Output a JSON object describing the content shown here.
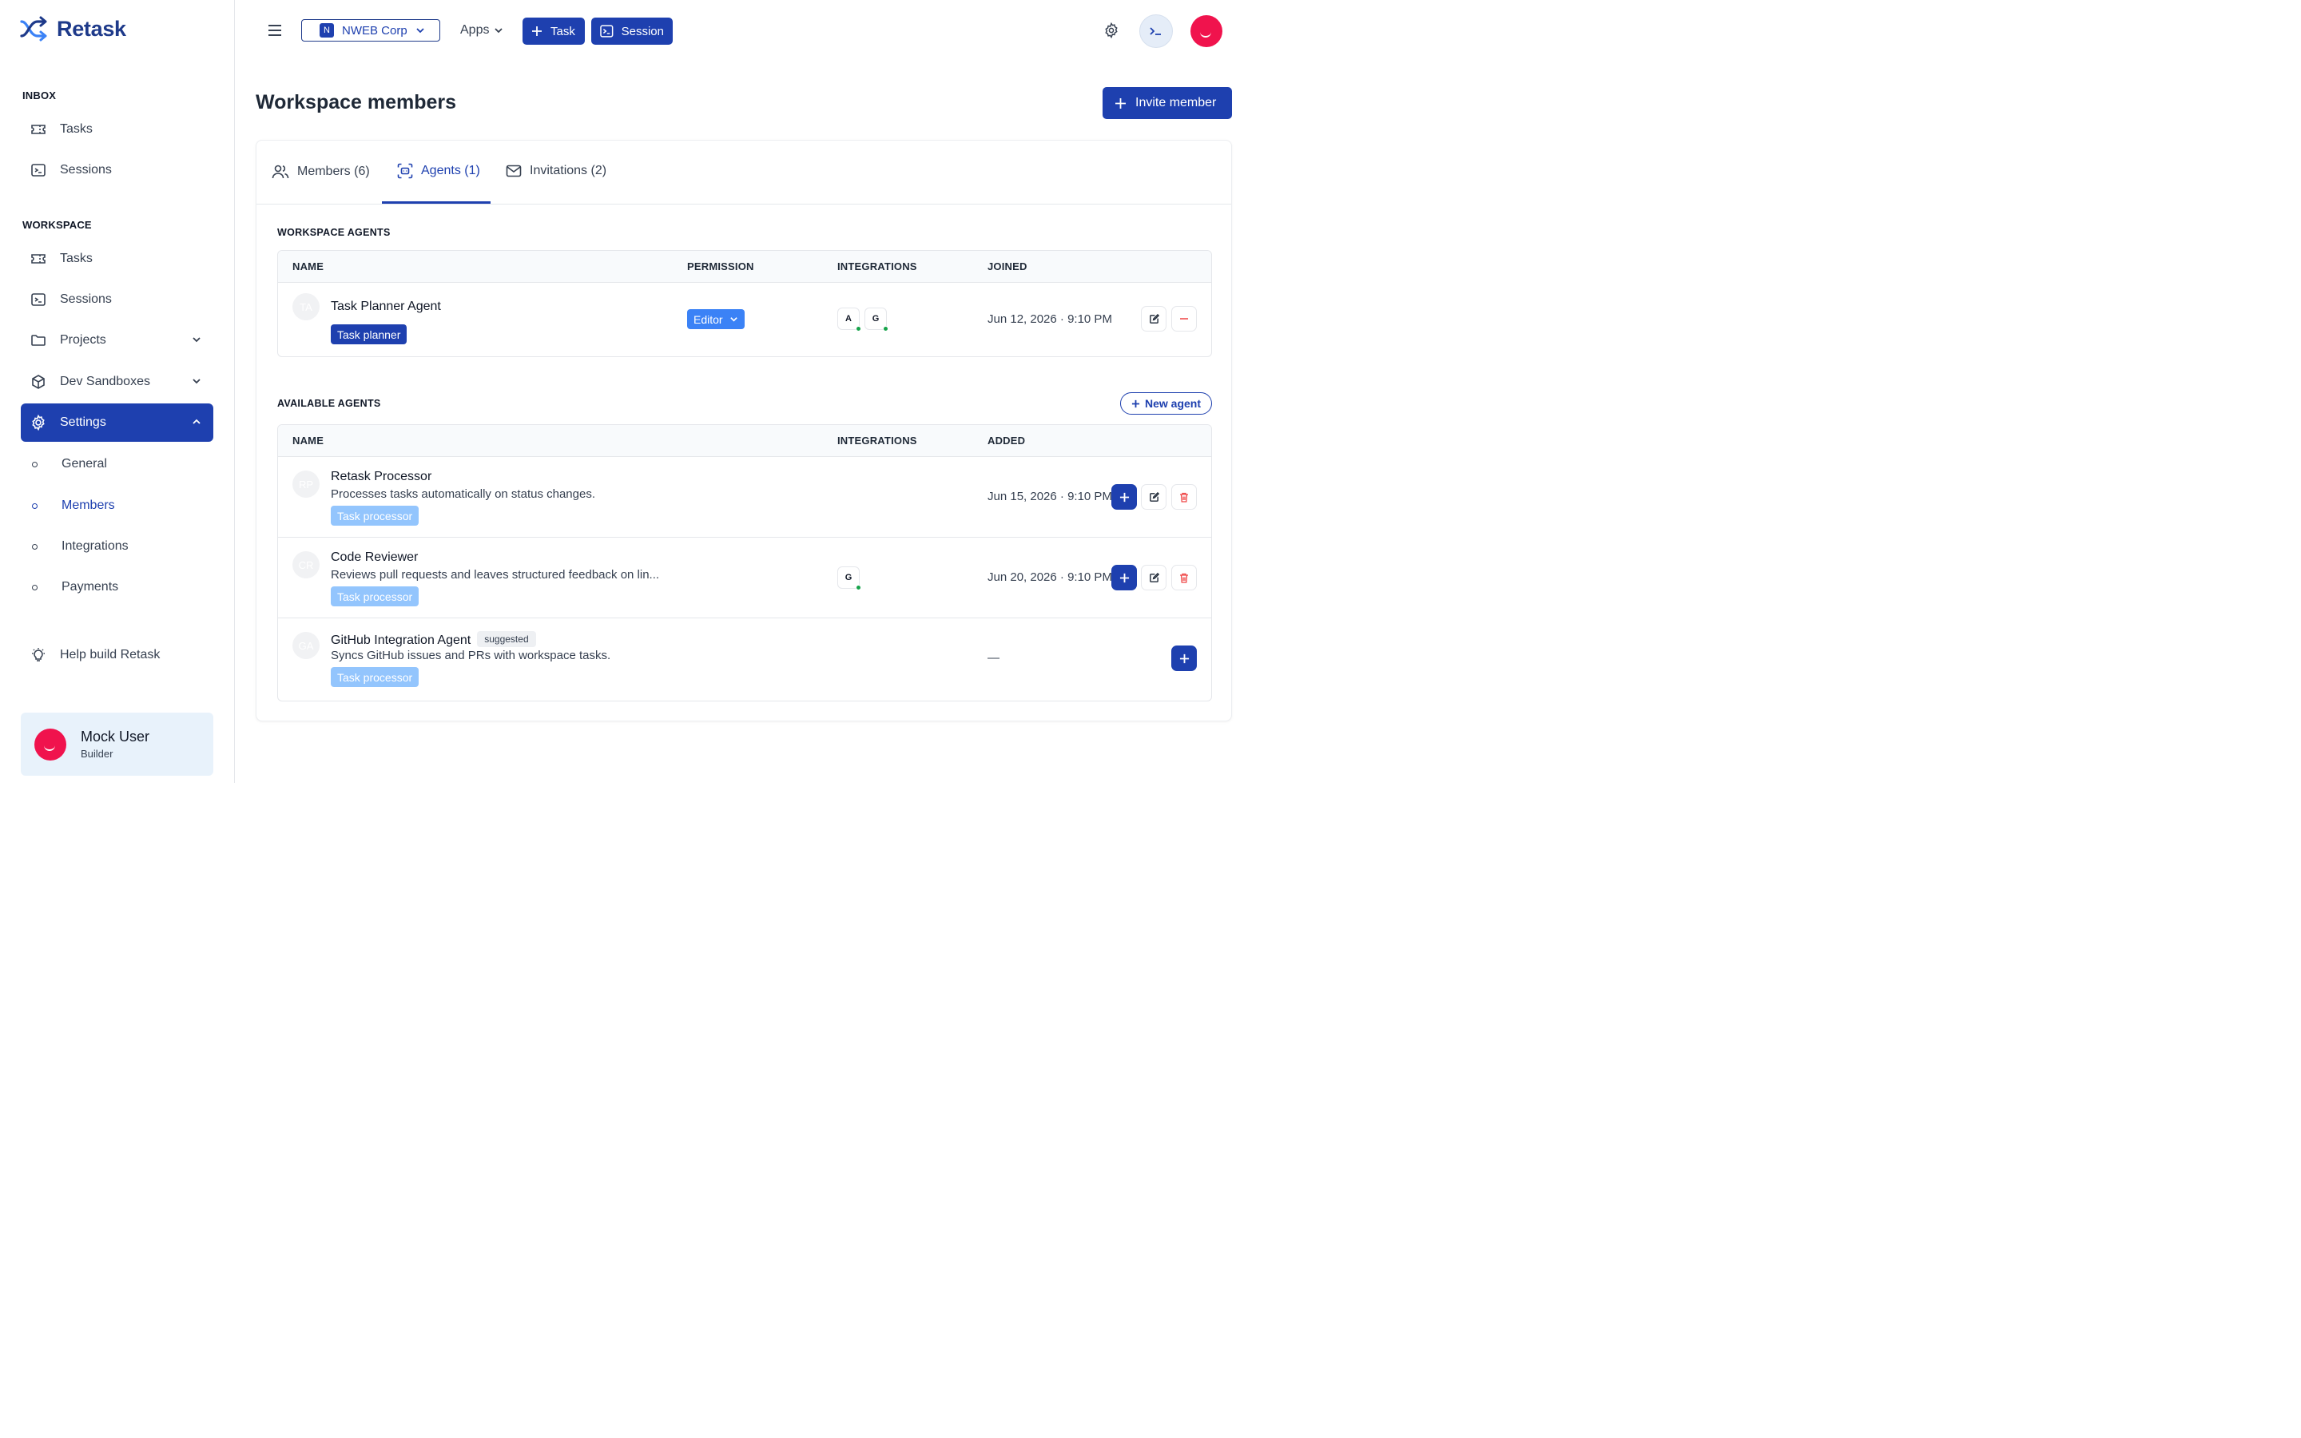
{
  "app": {
    "name": "Retask"
  },
  "sidebar": {
    "inbox_label": "INBOX",
    "inbox_items": [
      {
        "label": "Tasks"
      },
      {
        "label": "Sessions"
      }
    ],
    "workspace_label": "WORKSPACE",
    "workspace_items": [
      {
        "label": "Tasks"
      },
      {
        "label": "Sessions"
      },
      {
        "label": "Projects"
      },
      {
        "label": "Dev Sandboxes"
      },
      {
        "label": "Settings"
      }
    ],
    "settings_items": [
      {
        "label": "General"
      },
      {
        "label": "Members"
      },
      {
        "label": "Integrations"
      },
      {
        "label": "Payments"
      }
    ],
    "help_label": "Help build Retask",
    "user": {
      "name": "Mock User",
      "role": "Builder"
    }
  },
  "topbar": {
    "org_initial": "N",
    "org_name": "NWEB Corp",
    "apps_label": "Apps",
    "task_label": "Task",
    "session_label": "Session"
  },
  "page": {
    "title": "Workspace members",
    "invite_label": "Invite member"
  },
  "tabs": [
    {
      "label": "Members (6)"
    },
    {
      "label": "Agents (1)"
    },
    {
      "label": "Invitations (2)"
    }
  ],
  "workspace_agents": {
    "heading": "WORKSPACE AGENTS",
    "columns": {
      "name": "NAME",
      "permission": "PERMISSION",
      "integrations": "INTEGRATIONS",
      "joined": "JOINED"
    },
    "rows": [
      {
        "initials": "TA",
        "name": "Task Planner Agent",
        "tag": "Task planner",
        "permission": "Editor",
        "integrations": [
          "A",
          "G"
        ],
        "date": "Jun 12, 2026 · 9:10 PM"
      }
    ]
  },
  "available_agents": {
    "heading": "AVAILABLE AGENTS",
    "new_agent_label": "New agent",
    "columns": {
      "name": "NAME",
      "integrations": "INTEGRATIONS",
      "added": "ADDED"
    },
    "rows": [
      {
        "initials": "RP",
        "name": "Retask Processor",
        "description": "Processes tasks automatically on status changes.",
        "tag": "Task processor",
        "date": "Jun 15, 2026 · 9:10 PM"
      },
      {
        "initials": "CR",
        "name": "Code Reviewer",
        "description": "Reviews pull requests and leaves structured feedback on lin...",
        "tag": "Task processor",
        "integration": "G",
        "date": "Jun 20, 2026 · 9:10 PM"
      },
      {
        "initials": "GA",
        "name": "GitHub Integration Agent",
        "badge": "suggested",
        "description": "Syncs GitHub issues and PRs with workspace tasks.",
        "tag": "Task processor",
        "date": "—"
      }
    ]
  },
  "colors": {
    "primary": "#1e40af",
    "light_pill": "#93c5fd",
    "editor_pill": "#3b82f6",
    "avatar": "#f0134d",
    "status_green": "#16a34a",
    "danger": "#ef4444"
  }
}
